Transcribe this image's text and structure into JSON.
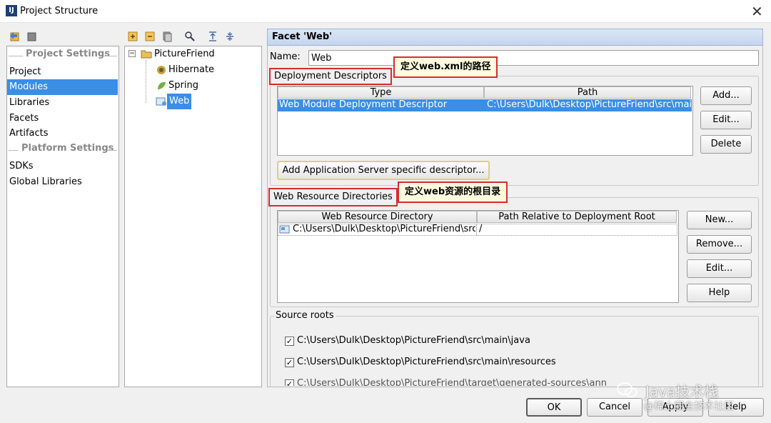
{
  "window": {
    "title": "Project Structure",
    "close": "✕"
  },
  "left_nav": {
    "project_settings_header": "Project Settings",
    "project_items": [
      "Project",
      "Modules",
      "Libraries",
      "Facets",
      "Artifacts"
    ],
    "platform_settings_header": "Platform Settings",
    "platform_items": [
      "SDKs",
      "Global Libraries"
    ],
    "selected": "Modules"
  },
  "tree": {
    "root": "PictureFriend",
    "children": [
      "Hibernate",
      "Spring",
      "Web"
    ],
    "selected": "Web"
  },
  "facet": {
    "header": "Facet 'Web'",
    "name_label": "Name:",
    "name_value": "Web",
    "deployment_descriptors": {
      "title": "Deployment Descriptors",
      "columns": [
        "Type",
        "Path"
      ],
      "rows": [
        {
          "type": "Web Module Deployment Descriptor",
          "path": "C:\\Users\\Dulk\\Desktop\\PictureFriend\\src\\main\\"
        }
      ],
      "buttons": [
        "Add...",
        "Edit...",
        "Delete"
      ],
      "add_server_button": "Add Application Server specific descriptor..."
    },
    "web_resource_directories": {
      "title": "Web Resource Directories",
      "columns": [
        "Web Resource Directory",
        "Path Relative to Deployment Root"
      ],
      "rows": [
        {
          "directory": "C:\\Users\\Dulk\\Desktop\\PictureFriend\\src...",
          "path": "/"
        }
      ],
      "buttons": [
        "New...",
        "Remove...",
        "Edit...",
        "Help"
      ]
    },
    "source_roots": {
      "title": "Source roots",
      "items": [
        "C:\\Users\\Dulk\\Desktop\\PictureFriend\\src\\main\\java",
        "C:\\Users\\Dulk\\Desktop\\PictureFriend\\src\\main\\resources",
        "C:\\Users\\Dulk\\Desktop\\PictureFriend\\target\\generated-sources\\annotatio"
      ]
    }
  },
  "annotations": {
    "web_xml": "定义web.xml的路径",
    "web_resources": "定义web资源的根目录"
  },
  "footer": {
    "ok": "OK",
    "cancel": "Cancel",
    "apply": "Apply",
    "help": "Help"
  },
  "watermark": {
    "line1": "Java技术栈",
    "line2": "@稀土掘金技术社区"
  }
}
